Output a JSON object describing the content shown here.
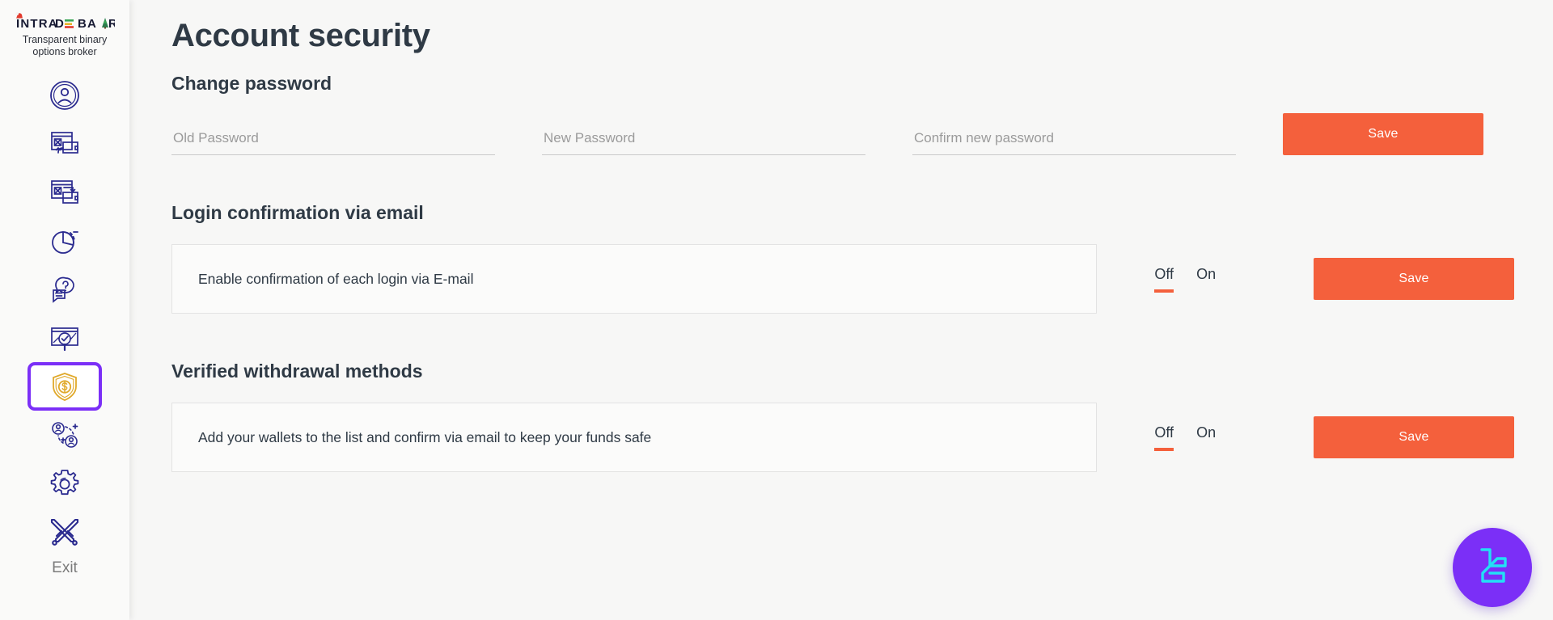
{
  "brand": {
    "logo_text": "INTRADE BAR",
    "tagline": "Transparent binary\noptions broker",
    "tagline_line1": "Transparent binary",
    "tagline_line2": "options broker"
  },
  "sidebar": {
    "items": [
      {
        "icon": "user-profile-icon",
        "name": "profile",
        "active": false
      },
      {
        "icon": "deposit-icon",
        "name": "deposit",
        "active": false
      },
      {
        "icon": "withdrawal-icon",
        "name": "withdrawal",
        "active": false
      },
      {
        "icon": "pie-chart-icon",
        "name": "statistics",
        "active": false
      },
      {
        "icon": "faq-chat-icon",
        "name": "support",
        "active": false
      },
      {
        "icon": "chart-search-icon",
        "name": "trade-history",
        "active": false
      },
      {
        "icon": "shield-dollar-icon",
        "name": "account-security",
        "active": true
      },
      {
        "icon": "referral-users-icon",
        "name": "referrals",
        "active": false
      },
      {
        "icon": "gear-icon",
        "name": "settings",
        "active": false
      }
    ],
    "exit": {
      "label": "Exit",
      "icon": "crossed-swords-icon"
    }
  },
  "page": {
    "title": "Account security"
  },
  "change_password": {
    "section_title": "Change password",
    "fields": [
      {
        "name": "old-password",
        "placeholder": "Old Password",
        "value": ""
      },
      {
        "name": "new-password",
        "placeholder": "New Password",
        "value": ""
      },
      {
        "name": "confirm-new-password",
        "placeholder": "Confirm new password",
        "value": ""
      }
    ],
    "save_label": "Save"
  },
  "login_confirmation": {
    "section_title": "Login confirmation via email",
    "card_text": "Enable confirmation of each login via E-mail",
    "toggle": {
      "off_label": "Off",
      "on_label": "On",
      "selected": "Off"
    },
    "save_label": "Save"
  },
  "withdrawal_methods": {
    "section_title": "Verified withdrawal methods",
    "card_text": "Add your wallets to the list and confirm via email to keep your funds safe",
    "toggle": {
      "off_label": "Off",
      "on_label": "On",
      "selected": "Off"
    },
    "save_label": "Save"
  },
  "fab": {
    "name": "chat-widget-button",
    "icon": "lc-logo-icon"
  },
  "colors": {
    "accent_orange": "#f4603c",
    "accent_purple": "#7b2ff7",
    "icon_navy": "#2a2a8f",
    "icon_gold": "#e0a92b",
    "page_bg": "#f7f7f6",
    "text_dark": "#2f3a45"
  }
}
